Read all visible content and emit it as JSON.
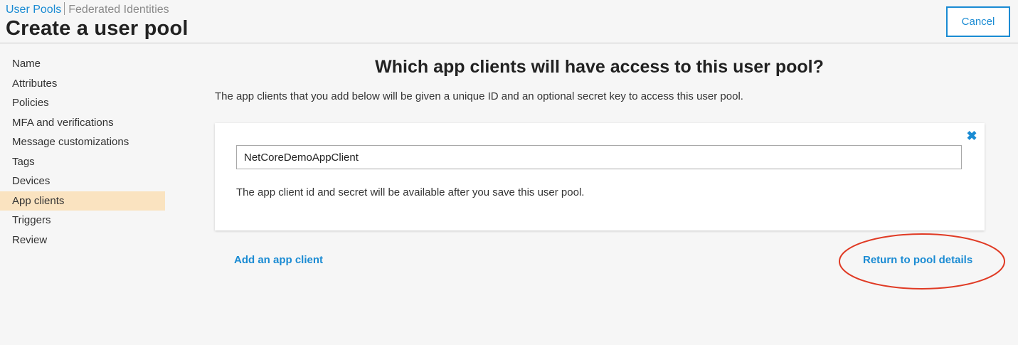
{
  "header": {
    "breadcrumb": {
      "active": "User Pools",
      "inactive": "Federated Identities"
    },
    "title": "Create a user pool",
    "cancel_label": "Cancel"
  },
  "sidebar": {
    "active_index": 7,
    "active_color": "#fae3c0",
    "items": [
      {
        "label": "Name"
      },
      {
        "label": "Attributes"
      },
      {
        "label": "Policies"
      },
      {
        "label": "MFA and verifications"
      },
      {
        "label": "Message customizations"
      },
      {
        "label": "Tags"
      },
      {
        "label": "Devices"
      },
      {
        "label": "App clients"
      },
      {
        "label": "Triggers"
      },
      {
        "label": "Review"
      }
    ]
  },
  "main": {
    "heading": "Which app clients will have access to this user pool?",
    "description": "The app clients that you add below will be given a unique ID and an optional secret key to access this user pool.",
    "client_card": {
      "remove_icon": "close-icon",
      "client_name_value": "NetCoreDemoAppClient",
      "note": "The app client id and secret will be available after you save this user pool."
    },
    "add_client_label": "Add an app client",
    "return_label": "Return to pool details"
  },
  "annotation": {
    "shape": "ellipse",
    "color": "#e03a24",
    "target": "return-to-pool-details-link"
  },
  "colors": {
    "accent": "#1a8bd3",
    "background": "#f6f6f6"
  }
}
